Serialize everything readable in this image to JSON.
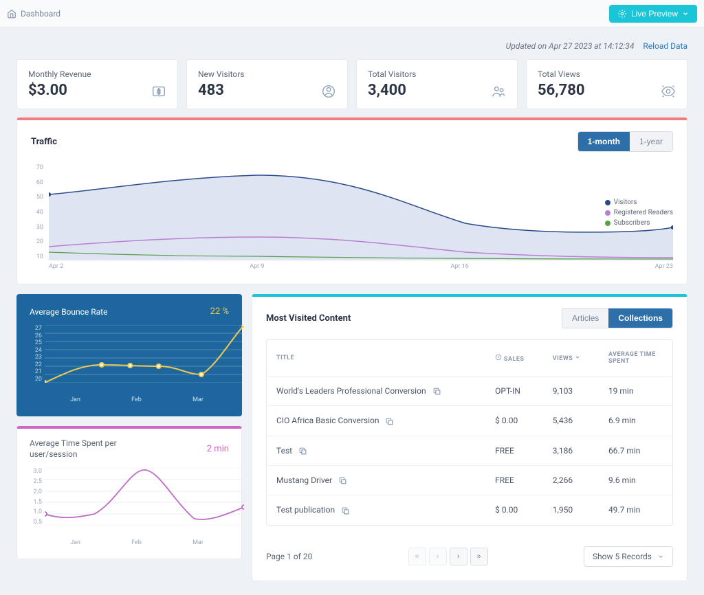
{
  "breadcrumb": {
    "label": "Dashboard"
  },
  "live_preview": "Live Preview",
  "updated": {
    "text": "Updated on Apr 27 2023 at 14:12:34",
    "reload": "Reload Data"
  },
  "stats": [
    {
      "label": "Monthly Revenue",
      "value": "$3.00",
      "icon": "dollar"
    },
    {
      "label": "New Visitors",
      "value": "483",
      "icon": "user-circle"
    },
    {
      "label": "Total Visitors",
      "value": "3,400",
      "icon": "users"
    },
    {
      "label": "Total Views",
      "value": "56,780",
      "icon": "eye"
    }
  ],
  "traffic": {
    "title": "Traffic",
    "tabs": {
      "month": "1-month",
      "year": "1-year"
    },
    "y_ticks": [
      "70",
      "60",
      "50",
      "40",
      "30",
      "20",
      "10"
    ],
    "x_ticks": [
      "Apr 2",
      "Apr 9",
      "Apr 16",
      "Apr 23"
    ],
    "legend": [
      {
        "label": "Visitors",
        "color": "#2b4a8c"
      },
      {
        "label": "Registered Readers",
        "color": "#b97fd0"
      },
      {
        "label": "Subscribers",
        "color": "#5aa04a"
      }
    ]
  },
  "bounce": {
    "title": "Average Bounce Rate",
    "value": "22 %",
    "y_ticks": [
      "27",
      "26",
      "25",
      "24",
      "23",
      "22",
      "21",
      "20"
    ],
    "x_ticks": [
      "Jan",
      "Feb",
      "Mar"
    ]
  },
  "time_spent": {
    "title": "Average Time Spent per user/session",
    "value": "2 min",
    "y_ticks": [
      "3.0",
      "2.5",
      "2.0",
      "1.5",
      "1.0",
      "0.5"
    ],
    "x_ticks": [
      "Jan",
      "Feb",
      "Mar"
    ]
  },
  "content": {
    "title": "Most Visited Content",
    "tabs": {
      "articles": "Articles",
      "collections": "Collections"
    },
    "columns": {
      "title": "TITLE",
      "sales": "SALES",
      "views": "VIEWS",
      "avg": "AVERAGE TIME SPENT"
    },
    "rows": [
      {
        "title": "World's Leaders Professional Conversion",
        "sales": "OPT-IN",
        "views": "9,103",
        "avg": "19 min"
      },
      {
        "title": "CIO Africa Basic Conversion",
        "sales": "$ 0.00",
        "views": "5,436",
        "avg": "6.9 min"
      },
      {
        "title": "Test",
        "sales": "FREE",
        "views": "3,186",
        "avg": "66.7 min"
      },
      {
        "title": "Mustang Driver",
        "sales": "FREE",
        "views": "2,266",
        "avg": "9.6 min"
      },
      {
        "title": "Test publication",
        "sales": "$ 0.00",
        "views": "1,950",
        "avg": "49.7 min"
      }
    ],
    "page_info": "Page 1 of 20",
    "show": "Show 5 Records"
  },
  "chart_data": [
    {
      "type": "line",
      "title": "Traffic",
      "xlabel": "",
      "ylabel": "",
      "x": [
        "Apr 2",
        "Apr 9",
        "Apr 16",
        "Apr 23"
      ],
      "ylim": [
        0,
        70
      ],
      "series": [
        {
          "name": "Visitors",
          "color": "#2b4a8c",
          "values": [
            48,
            62,
            27,
            22
          ]
        },
        {
          "name": "Registered Readers",
          "color": "#b97fd0",
          "values": [
            10,
            17,
            6,
            2
          ]
        },
        {
          "name": "Subscribers",
          "color": "#5aa04a",
          "values": [
            6,
            3,
            1,
            1
          ]
        }
      ]
    },
    {
      "type": "line",
      "title": "Average Bounce Rate",
      "x": [
        "Jan",
        "Feb",
        "Mar",
        ""
      ],
      "ylim": [
        20,
        27
      ],
      "series": [
        {
          "name": "Bounce %",
          "color": "#f0c94f",
          "values_detailed": [
            20,
            22.2,
            22.2,
            22,
            22,
            21,
            23,
            27
          ]
        }
      ]
    },
    {
      "type": "line",
      "title": "Average Time Spent per user/session",
      "x": [
        "Jan",
        "Feb",
        "Mar",
        ""
      ],
      "ylim": [
        0.5,
        3.0
      ],
      "series": [
        {
          "name": "Minutes",
          "color": "#c06bc9",
          "values_detailed": [
            1.0,
            0.8,
            1.0,
            2.9,
            1.6,
            0.8,
            1.0,
            1.3
          ]
        }
      ]
    }
  ]
}
